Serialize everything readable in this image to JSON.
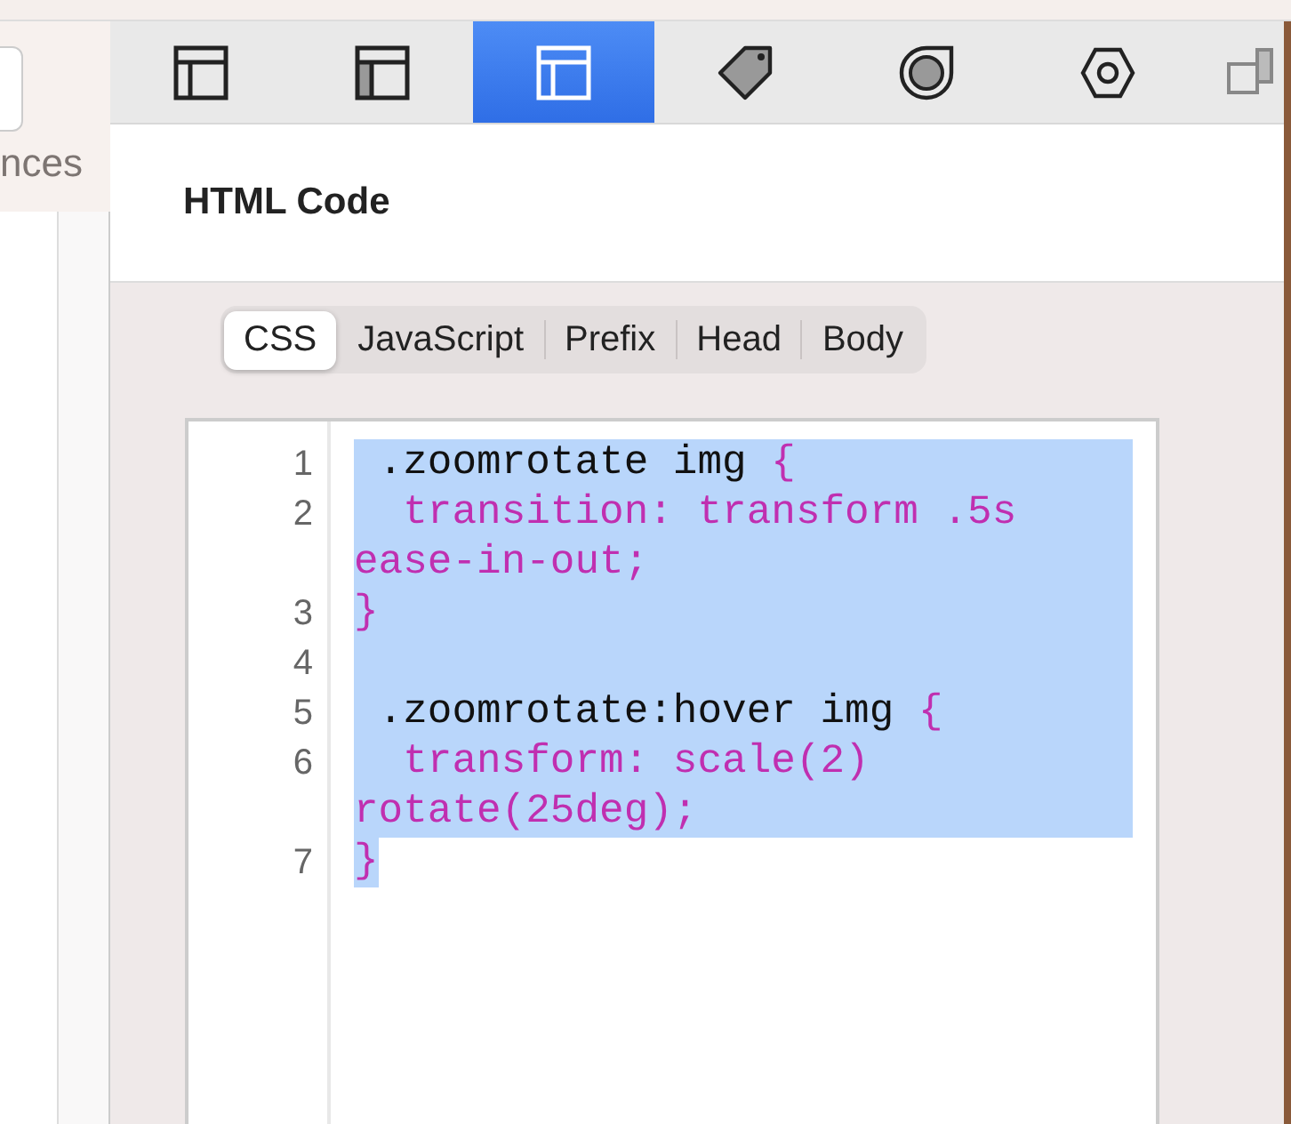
{
  "sidebar": {
    "label": "nces"
  },
  "toolbar": {
    "tabs": [
      {
        "selected": false
      },
      {
        "selected": false
      },
      {
        "selected": true
      },
      {
        "selected": false
      },
      {
        "selected": false
      },
      {
        "selected": false
      },
      {
        "selected": false
      }
    ]
  },
  "section": {
    "title": "HTML Code"
  },
  "code_tabs": [
    {
      "label": "CSS",
      "selected": true
    },
    {
      "label": "JavaScript",
      "selected": false
    },
    {
      "label": "Prefix",
      "selected": false
    },
    {
      "label": "Head",
      "selected": false
    },
    {
      "label": "Body",
      "selected": false
    }
  ],
  "editor": {
    "rows": [
      {
        "number": "1",
        "selected": true,
        "parts": [
          {
            "text": " .zoomrotate img ",
            "kind": "selector"
          },
          {
            "text": "{",
            "kind": "value"
          }
        ]
      },
      {
        "number": "2",
        "selected": true,
        "parts": [
          {
            "text": "  transition: transform .5s",
            "kind": "value"
          }
        ]
      },
      {
        "selected": true,
        "parts": [
          {
            "text": "ease-in-out;",
            "kind": "value"
          }
        ]
      },
      {
        "number": "3",
        "selected": true,
        "parts": [
          {
            "text": "}",
            "kind": "value"
          }
        ]
      },
      {
        "number": "4",
        "selected": true,
        "parts": []
      },
      {
        "number": "5",
        "selected": true,
        "parts": [
          {
            "text": " .zoomrotate:hover img ",
            "kind": "selector"
          },
          {
            "text": "{",
            "kind": "value"
          }
        ]
      },
      {
        "number": "6",
        "selected": true,
        "parts": [
          {
            "text": "  transform: scale(2)",
            "kind": "value"
          }
        ]
      },
      {
        "selected": true,
        "parts": [
          {
            "text": "rotate(25deg);",
            "kind": "value"
          }
        ]
      },
      {
        "number": "7",
        "selected": false,
        "parts": [
          {
            "text": "}",
            "kind": "value",
            "selected": true
          }
        ]
      }
    ]
  }
}
